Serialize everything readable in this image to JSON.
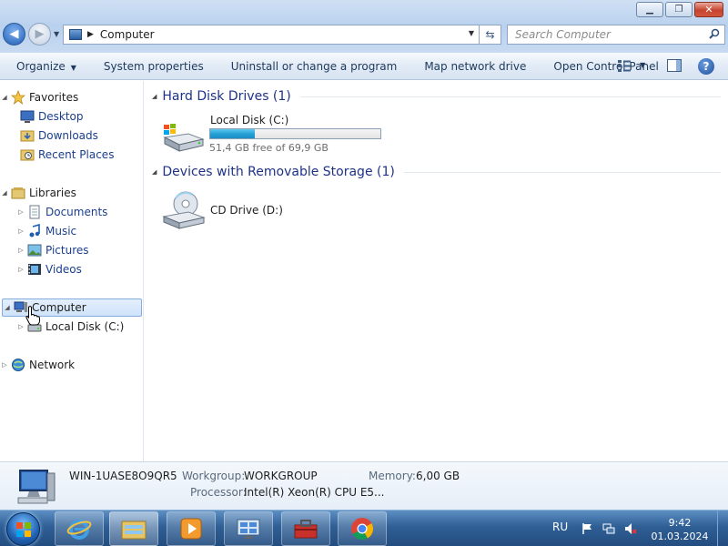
{
  "window": {
    "minimize_glyph": "▁",
    "maximize_glyph": "❐",
    "close_glyph": "✕"
  },
  "address": {
    "path": "Computer",
    "search_placeholder": "Search Computer"
  },
  "commandbar": {
    "organize": "Organize",
    "system_properties": "System properties",
    "uninstall": "Uninstall or change a program",
    "map_drive": "Map network drive",
    "control_panel": "Open Control Panel",
    "help": "?"
  },
  "navpane": {
    "favorites": "Favorites",
    "desktop": "Desktop",
    "downloads": "Downloads",
    "recent_places": "Recent Places",
    "libraries": "Libraries",
    "documents": "Documents",
    "music": "Music",
    "pictures": "Pictures",
    "videos": "Videos",
    "computer": "Computer",
    "local_disk": "Local Disk (C:)",
    "network": "Network"
  },
  "content": {
    "hdd_group": "Hard Disk Drives (1)",
    "removable_group": "Devices with Removable Storage (1)",
    "local_disk_name": "Local Disk (C:)",
    "local_disk_free": "51,4 GB free of 69,9 GB",
    "local_disk_used_fraction": 0.26,
    "cd_drive_name": "CD Drive (D:)"
  },
  "details": {
    "computer_name": "WIN-1UASE8O9QR5",
    "workgroup_label": "Workgroup:",
    "workgroup_value": "WORKGROUP",
    "memory_label": "Memory:",
    "memory_value": "6,00 GB",
    "processor_label": "Processor:",
    "processor_value": "Intel(R) Xeon(R) CPU E5..."
  },
  "taskbar": {
    "language": "RU",
    "time": "9:42",
    "date": "01.03.2024"
  },
  "colors": {
    "accent": "#1e3287",
    "link": "#1a3e8e",
    "progress": "#25a1d6"
  }
}
